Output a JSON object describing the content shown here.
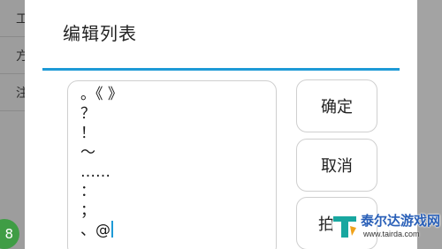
{
  "background_list": {
    "items": [
      {
        "label": "工"
      },
      {
        "label": "方"
      },
      {
        "label": "注"
      }
    ],
    "badge": "8"
  },
  "dialog": {
    "title": "编辑列表",
    "text_lines": [
      "。《 》",
      "？",
      "！",
      "～",
      "……",
      "：",
      "；",
      "、@"
    ],
    "buttons": {
      "confirm": "确定",
      "cancel": "取消",
      "third": "拍"
    }
  },
  "watermark": {
    "name": "泰尔达游戏网",
    "url": "www.tairda.com"
  },
  "colors": {
    "accent": "#1e9ad6",
    "badge": "#3f9d45",
    "overlay": "#9d9d9d"
  }
}
